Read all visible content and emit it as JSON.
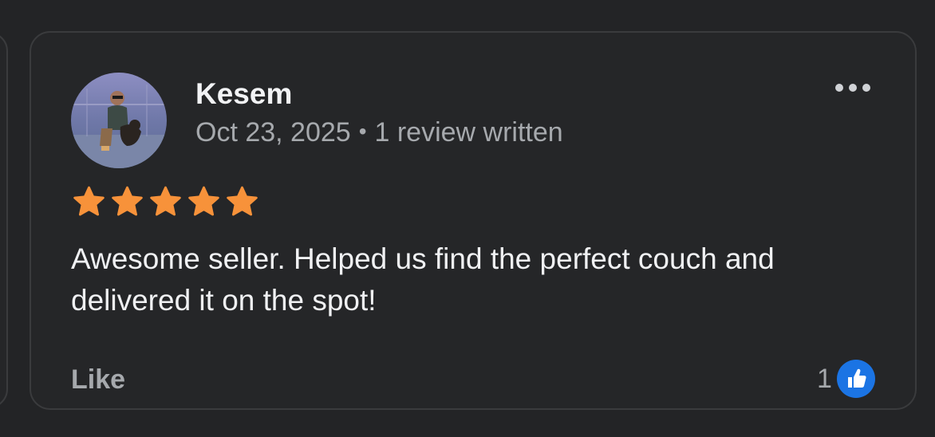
{
  "review": {
    "reviewer_name": "Kesem",
    "date": "Oct 23, 2025",
    "separator": "•",
    "reviews_written": "1 review written",
    "rating": 5,
    "rating_max": 5,
    "text": "Awesome seller. Helped us find the perfect couch and delivered it on the spot!",
    "like_label": "Like",
    "reaction_count": "1",
    "reaction_icon": "thumbs-up-icon",
    "menu_icon": "more-options-icon"
  },
  "colors": {
    "background": "#232426",
    "card": "#252628",
    "star": "#f7923a",
    "like_badge": "#1b74e4"
  }
}
